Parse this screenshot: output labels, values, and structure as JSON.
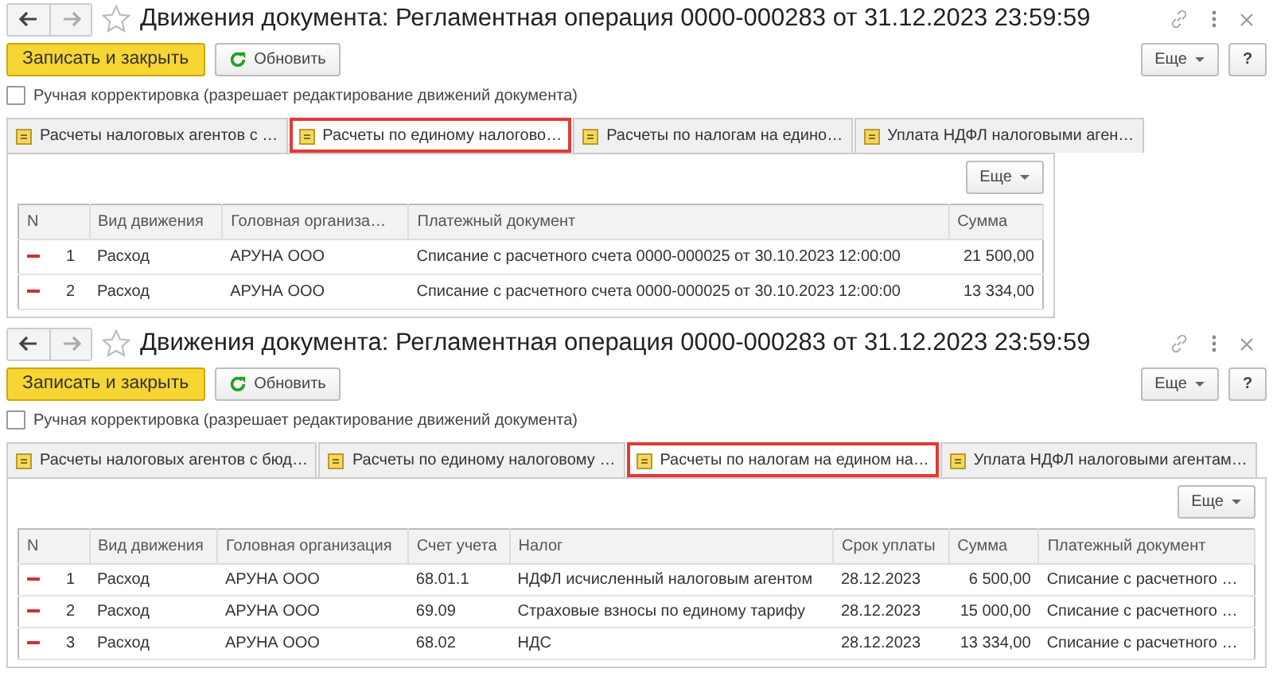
{
  "windows": [
    {
      "title": "Движения документа: Регламентная операция 0000-000283 от 31.12.2023 23:59:59",
      "save_button": "Записать и закрыть",
      "refresh_button": "Обновить",
      "more_button": "Еще",
      "help_button": "?",
      "manual_edit": {
        "label": "Ручная корректировка (разрешает редактирование движений документа)",
        "checked": false
      },
      "tabs": [
        {
          "label": "Расчеты налоговых агентов с …",
          "selected": false
        },
        {
          "label": "Расчеты по единому налогово…",
          "selected": true
        },
        {
          "label": "Расчеты по налогам на едино…",
          "selected": false
        },
        {
          "label": "Уплата НДФЛ налоговыми аген…",
          "selected": false
        }
      ],
      "table_more_button": "Еще",
      "columns": [
        {
          "label": "N",
          "kind": "number"
        },
        {
          "label": "Вид движения",
          "kind": "text"
        },
        {
          "label": "Головная организа…",
          "kind": "text"
        },
        {
          "label": "Платежный документ",
          "kind": "text"
        },
        {
          "label": "Сумма",
          "kind": "amount"
        }
      ],
      "rows": [
        {
          "cells": [
            "1",
            "Расход",
            "АРУНА ООО",
            "Списание с расчетного счета 0000-000025 от 30.10.2023 12:00:00",
            "21 500,00"
          ]
        },
        {
          "cells": [
            "2",
            "Расход",
            "АРУНА ООО",
            "Списание с расчетного счета 0000-000025 от 30.10.2023 12:00:00",
            "13 334,00"
          ]
        }
      ]
    },
    {
      "title": "Движения документа: Регламентная операция 0000-000283 от 31.12.2023 23:59:59",
      "save_button": "Записать и закрыть",
      "refresh_button": "Обновить",
      "more_button": "Еще",
      "help_button": "?",
      "manual_edit": {
        "label": "Ручная корректировка (разрешает редактирование движений документа)",
        "checked": false
      },
      "tabs": [
        {
          "label": "Расчеты налоговых агентов с бюд…",
          "selected": false
        },
        {
          "label": "Расчеты по единому налоговому …",
          "selected": false
        },
        {
          "label": "Расчеты по налогам на едином на…",
          "selected": true
        },
        {
          "label": "Уплата НДФЛ налоговыми агентам…",
          "selected": false
        }
      ],
      "table_more_button": "Еще",
      "columns": [
        {
          "label": "N",
          "kind": "number"
        },
        {
          "label": "Вид движения",
          "kind": "text"
        },
        {
          "label": "Головная организация",
          "kind": "text"
        },
        {
          "label": "Счет учета",
          "kind": "text"
        },
        {
          "label": "Налог",
          "kind": "text"
        },
        {
          "label": "Срок уплаты",
          "kind": "text"
        },
        {
          "label": "Сумма",
          "kind": "amount"
        },
        {
          "label": "Платежный документ",
          "kind": "text"
        }
      ],
      "rows": [
        {
          "cells": [
            "1",
            "Расход",
            "АРУНА ООО",
            "68.01.1",
            "НДФЛ исчисленный налоговым агентом",
            "28.12.2023",
            "6 500,00",
            "Списание с расчетного …"
          ]
        },
        {
          "cells": [
            "2",
            "Расход",
            "АРУНА ООО",
            "69.09",
            "Страховые взносы по единому тарифу",
            "28.12.2023",
            "15 000,00",
            "Списание с расчетного …"
          ]
        },
        {
          "cells": [
            "3",
            "Расход",
            "АРУНА ООО",
            "68.02",
            "НДС",
            "28.12.2023",
            "13 334,00",
            "Списание с расчетного …"
          ]
        }
      ]
    }
  ]
}
